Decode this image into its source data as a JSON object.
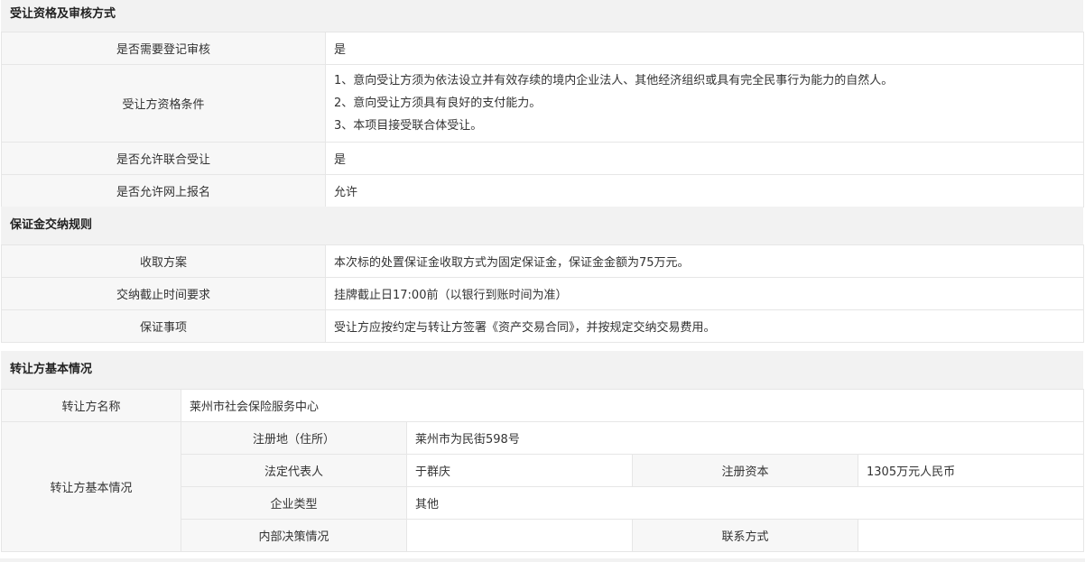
{
  "section1": {
    "title": "受让资格及审核方式",
    "rows": [
      {
        "label": "是否需要登记审核",
        "value": "是"
      },
      {
        "label": "受让方资格条件",
        "lines": [
          "1、意向受让方须为依法设立并有效存续的境内企业法人、其他经济组织或具有完全民事行为能力的自然人。",
          "2、意向受让方须具有良好的支付能力。",
          "3、本项目接受联合体受让。"
        ]
      },
      {
        "label": "是否允许联合受让",
        "value": "是"
      },
      {
        "label": "是否允许网上报名",
        "value": "允许"
      }
    ]
  },
  "section2": {
    "title": "保证金交纳规则",
    "rows": [
      {
        "label": "收取方案",
        "value": "本次标的处置保证金收取方式为固定保证金，保证金金额为75万元。"
      },
      {
        "label": "交纳截止时间要求",
        "value": "挂牌截止日17:00前（以银行到账时间为准）"
      },
      {
        "label": "保证事项",
        "value": "受让方应按约定与转让方签署《资产交易合同》，并按规定交纳交易费用。"
      }
    ]
  },
  "section3": {
    "title": "转让方基本情况",
    "name_label": "转让方名称",
    "name_value": "莱州市社会保险服务中心",
    "basic_label": "转让方基本情况",
    "reg_addr_label": "注册地（住所）",
    "reg_addr_value": "莱州市为民街598号",
    "legal_rep_label": "法定代表人",
    "legal_rep_value": "于群庆",
    "reg_capital_label": "注册资本",
    "reg_capital_value": "1305万元人民币",
    "company_type_label": "企业类型",
    "company_type_value": "其他",
    "internal_decision_label": "内部决策情况",
    "internal_decision_value": "",
    "contact_label": "联系方式",
    "contact_value": ""
  }
}
